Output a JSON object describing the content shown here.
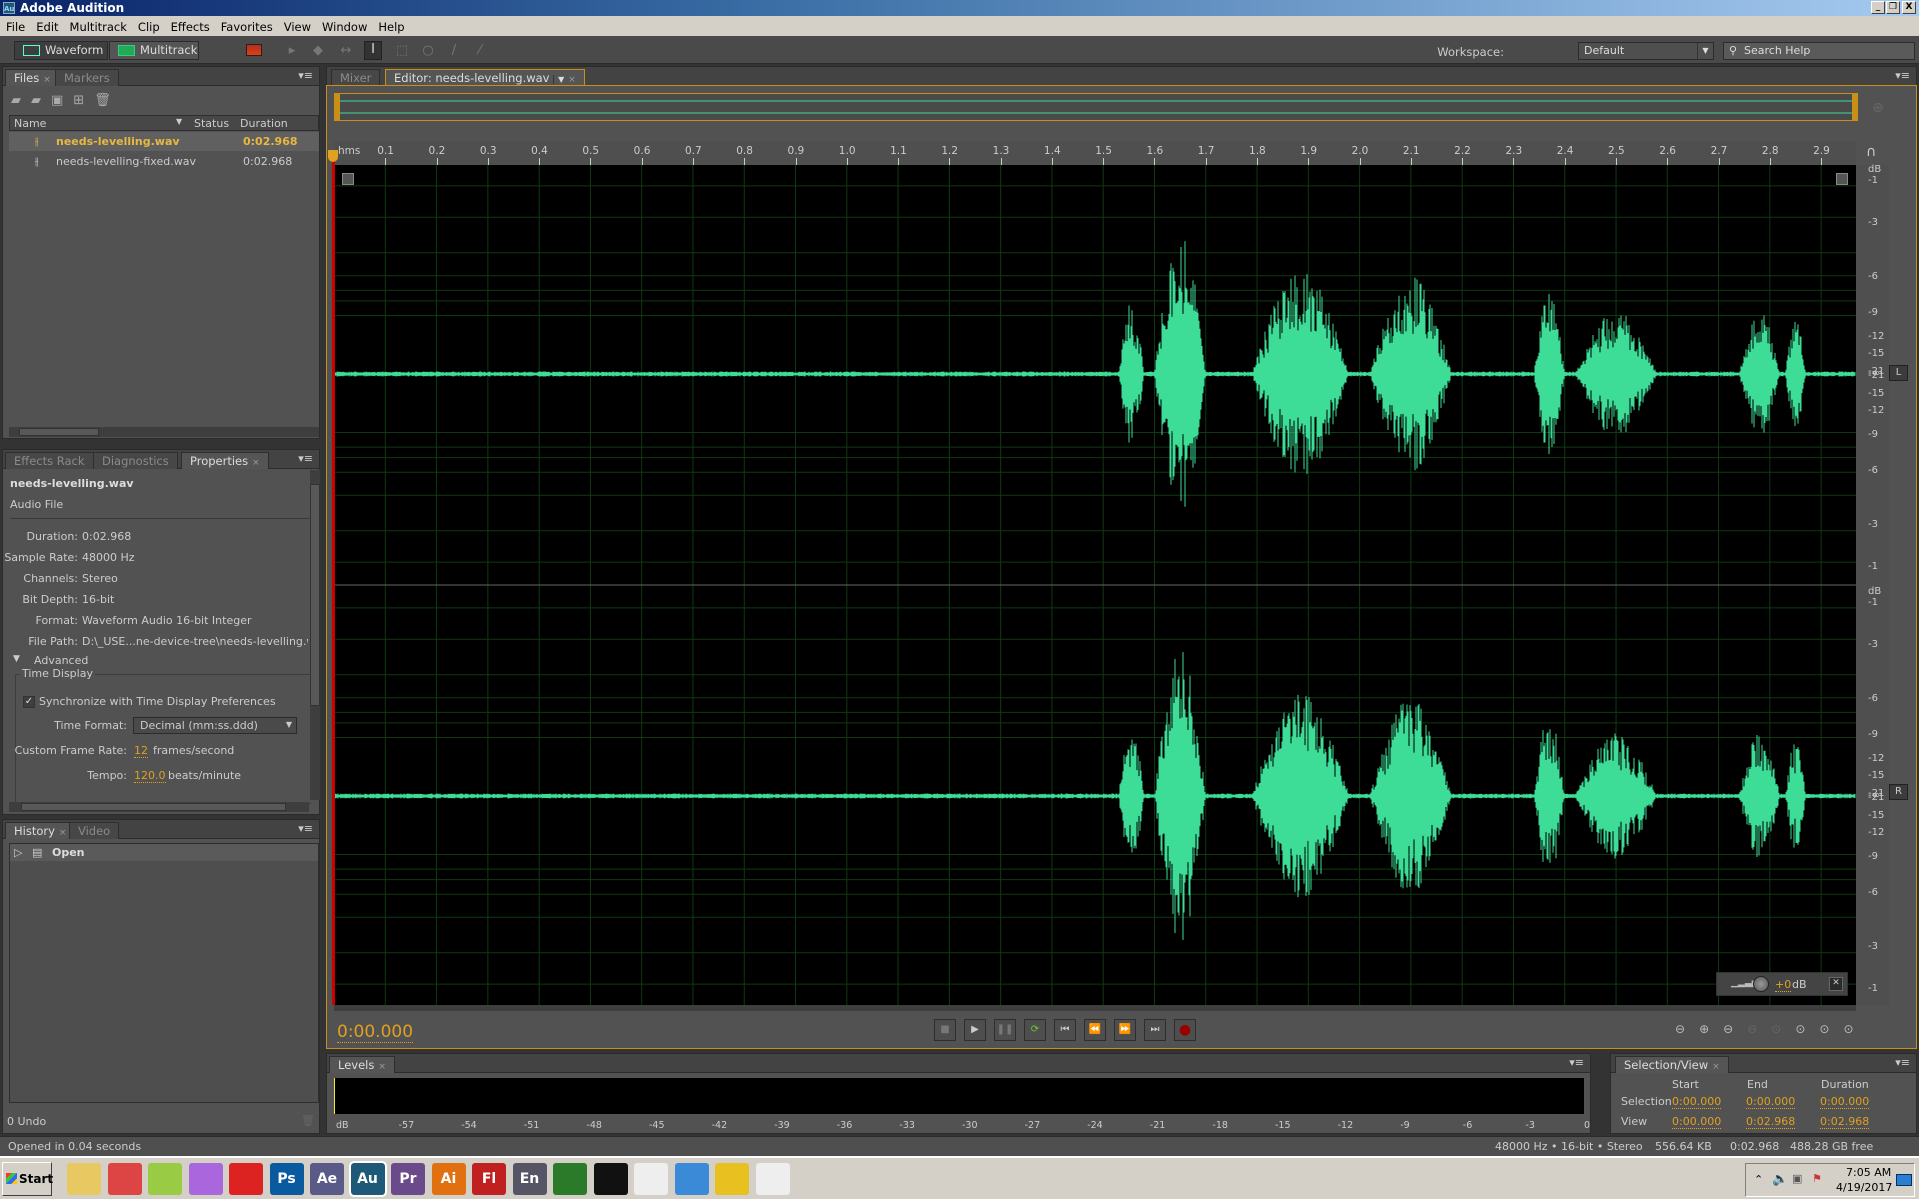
{
  "window": {
    "title": "Adobe Audition",
    "app_icon": "Au"
  },
  "menu": [
    "File",
    "Edit",
    "Multitrack",
    "Clip",
    "Effects",
    "Favorites",
    "View",
    "Window",
    "Help"
  ],
  "toolbar": {
    "waveform_label": "Waveform",
    "multitrack_label": "Multitrack",
    "workspace_label": "Workspace:",
    "workspace_value": "Default",
    "search_placeholder": "Search Help"
  },
  "files_panel": {
    "tabs": [
      "Files",
      "Markers"
    ],
    "columns": [
      "Name",
      "Status",
      "Duration"
    ],
    "files": [
      {
        "name": "needs-levelling.wav",
        "status": "",
        "duration": "0:02.968",
        "selected": true
      },
      {
        "name": "needs-levelling-fixed.wav",
        "status": "",
        "duration": "0:02.968",
        "selected": false
      }
    ]
  },
  "properties_panel": {
    "tabs": [
      "Effects Rack",
      "Diagnostics",
      "Properties"
    ],
    "file_name": "needs-levelling.wav",
    "file_type": "Audio File",
    "fields": [
      {
        "label": "Duration:",
        "value": "0:02.968"
      },
      {
        "label": "Sample Rate:",
        "value": "48000 Hz"
      },
      {
        "label": "Channels:",
        "value": "Stereo"
      },
      {
        "label": "Bit Depth:",
        "value": "16-bit"
      },
      {
        "label": "Format:",
        "value": "Waveform Audio 16-bit Integer"
      },
      {
        "label": "File Path:",
        "value": "D:\\_USE...ne-device-tree\\needs-levelling.wav"
      }
    ],
    "advanced_label": "Advanced",
    "time_display_label": "Time Display",
    "sync_label": "Synchronize with Time Display Preferences",
    "sync_checked": true,
    "time_format_label": "Time Format:",
    "time_format_value": "Decimal (mm:ss.ddd)",
    "frame_rate_label": "Custom Frame Rate:",
    "frame_rate_value": "12",
    "frame_rate_unit": "frames/second",
    "tempo_label": "Tempo:",
    "tempo_value": "120.0",
    "tempo_unit": "beats/minute"
  },
  "history_panel": {
    "tabs": [
      "History",
      "Video"
    ],
    "items": [
      "Open"
    ],
    "undo_count": "0 Undo"
  },
  "editor": {
    "tabs": [
      "Mixer",
      "Editor: needs-levelling.wav"
    ],
    "ruler_unit": "hms",
    "ruler_ticks": [
      "0.1",
      "0.2",
      "0.3",
      "0.4",
      "0.5",
      "0.6",
      "0.7",
      "0.8",
      "0.9",
      "1.0",
      "1.1",
      "1.2",
      "1.3",
      "1.4",
      "1.5",
      "1.6",
      "1.7",
      "1.8",
      "1.9",
      "2.0",
      "2.1",
      "2.2",
      "2.3",
      "2.4",
      "2.5",
      "2.6",
      "2.7",
      "2.8",
      "2.9"
    ],
    "db_scale": [
      "dB",
      "-1",
      "-3",
      "-6",
      "-9",
      "-12",
      "-15",
      "-21",
      "-∞",
      "-21",
      "-15",
      "-12",
      "-9",
      "-6",
      "-3",
      "-1"
    ],
    "channels": [
      "L",
      "R"
    ],
    "current_time": "0:00.000",
    "gain_value": "+0",
    "gain_unit": "dB"
  },
  "levels_panel": {
    "tab": "Levels",
    "scale": [
      "dB",
      "-57",
      "-54",
      "-51",
      "-48",
      "-45",
      "-42",
      "-39",
      "-36",
      "-33",
      "-30",
      "-27",
      "-24",
      "-21",
      "-18",
      "-15",
      "-12",
      "-9",
      "-6",
      "-3",
      "0"
    ]
  },
  "selection_view": {
    "tab": "Selection/View",
    "columns": [
      "Start",
      "End",
      "Duration"
    ],
    "rows": [
      {
        "label": "Selection",
        "start": "0:00.000",
        "end": "0:00.000",
        "duration": "0:00.000"
      },
      {
        "label": "View",
        "start": "0:00.000",
        "end": "0:02.968",
        "duration": "0:02.968"
      }
    ]
  },
  "status": {
    "message": "Opened in 0.04 seconds",
    "format": "48000 Hz • 16-bit • Stereo",
    "size": "556.64 KB",
    "duration": "0:02.968",
    "free": "488.28 GB free"
  },
  "taskbar": {
    "start_label": "Start",
    "apps": [
      "explorer",
      "chrome",
      "notepad++",
      "picasa",
      "mathematica",
      "Ps",
      "Ae",
      "Au",
      "Pr",
      "Ai",
      "Fl",
      "En",
      "excel",
      "cmd",
      "doc",
      "itunes",
      "vmware",
      "doc2"
    ],
    "time": "7:05 AM",
    "date": "4/19/2017"
  },
  "colors": {
    "accent": "#e0a020",
    "waveform": "#3ddc97",
    "grid": "#0e3a12"
  }
}
